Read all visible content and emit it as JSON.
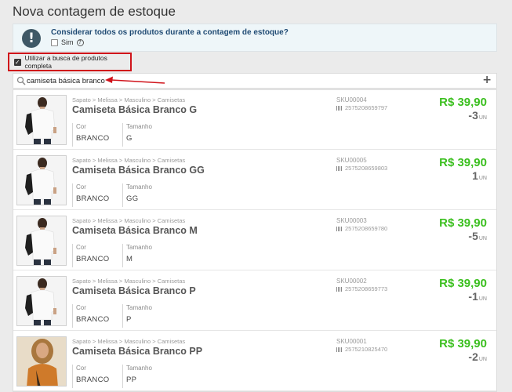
{
  "page": {
    "title": "Nova contagem de estoque"
  },
  "notice": {
    "question": "Considerar todos os produtos durante a contagem de estoque?",
    "option_label": "Sim",
    "icon": "exclamation-icon"
  },
  "full_search": {
    "label": "Utilizar a busca de produtos completa",
    "checked": true
  },
  "search": {
    "value": "camiseta básica branco",
    "placeholder": ""
  },
  "colors": {
    "price": "#3bbf1f",
    "highlight": "#d0131a",
    "notice_bg": "#eef6f9"
  },
  "labels": {
    "cor": "Cor",
    "tamanho": "Tamanho",
    "unit": "UN",
    "sep": ">"
  },
  "products": [
    {
      "breadcrumb": [
        "Sapato",
        "Melissa",
        "Masculino",
        "Camisetas"
      ],
      "name": "Camiseta Básica Branco G",
      "cor": "BRANCO",
      "tamanho": "G",
      "sku": "SKU00004",
      "ean": "2575208659797",
      "price": "R$ 39,90",
      "qty": "-3",
      "image": "tshirt"
    },
    {
      "breadcrumb": [
        "Sapato",
        "Melissa",
        "Masculino",
        "Camisetas"
      ],
      "name": "Camiseta Básica Branco GG",
      "cor": "BRANCO",
      "tamanho": "GG",
      "sku": "SKU00005",
      "ean": "2575208659803",
      "price": "R$ 39,90",
      "qty": "1",
      "image": "tshirt"
    },
    {
      "breadcrumb": [
        "Sapato",
        "Melissa",
        "Masculino",
        "Camisetas"
      ],
      "name": "Camiseta Básica Branco M",
      "cor": "BRANCO",
      "tamanho": "M",
      "sku": "SKU00003",
      "ean": "2575208659780",
      "price": "R$ 39,90",
      "qty": "-5",
      "image": "tshirt"
    },
    {
      "breadcrumb": [
        "Sapato",
        "Melissa",
        "Masculino",
        "Camisetas"
      ],
      "name": "Camiseta Básica Branco P",
      "cor": "BRANCO",
      "tamanho": "P",
      "sku": "SKU00002",
      "ean": "2575208659773",
      "price": "R$ 39,90",
      "qty": "-1",
      "image": "tshirt"
    },
    {
      "breadcrumb": [
        "Sapato",
        "Melissa",
        "Masculino",
        "Camisetas"
      ],
      "name": "Camiseta Básica Branco PP",
      "cor": "BRANCO",
      "tamanho": "PP",
      "sku": "SKU00001",
      "ean": "2575210825470",
      "price": "R$ 39,90",
      "qty": "-2",
      "image": "woman-photo"
    }
  ]
}
